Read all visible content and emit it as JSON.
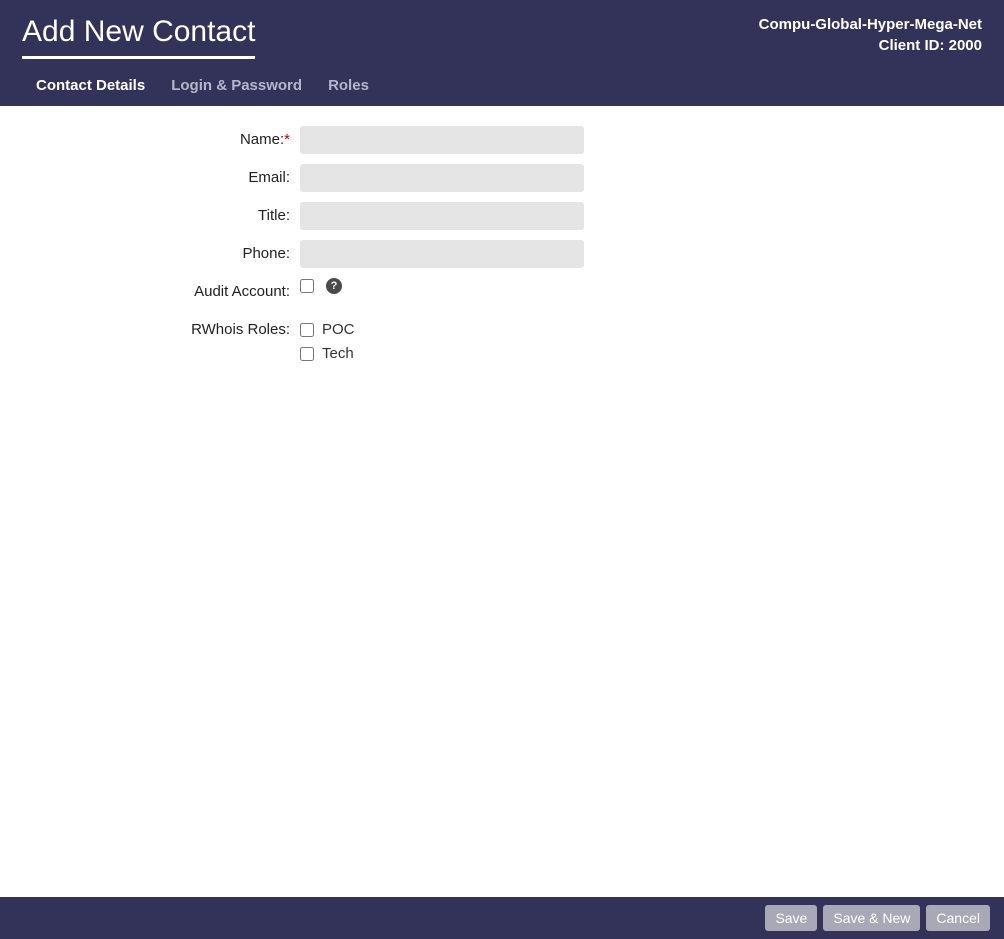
{
  "header": {
    "title": "Add New Contact",
    "client_name": "Compu-Global-Hyper-Mega-Net",
    "client_id_label": "Client ID: 2000"
  },
  "tabs": [
    {
      "label": "Contact Details",
      "active": true
    },
    {
      "label": "Login & Password",
      "active": false
    },
    {
      "label": "Roles",
      "active": false
    }
  ],
  "form": {
    "name": {
      "label": "Name:",
      "required": true,
      "value": ""
    },
    "email": {
      "label": "Email:",
      "required": false,
      "value": ""
    },
    "title": {
      "label": "Title:",
      "required": false,
      "value": ""
    },
    "phone": {
      "label": "Phone:",
      "required": false,
      "value": ""
    },
    "audit_account": {
      "label": "Audit Account:",
      "checked": false
    },
    "rwhois_roles": {
      "label": "RWhois Roles:",
      "options": [
        {
          "label": "POC",
          "checked": false
        },
        {
          "label": "Tech",
          "checked": false
        }
      ]
    },
    "required_mark": "*"
  },
  "footer": {
    "save": "Save",
    "save_new": "Save & New",
    "cancel": "Cancel"
  }
}
